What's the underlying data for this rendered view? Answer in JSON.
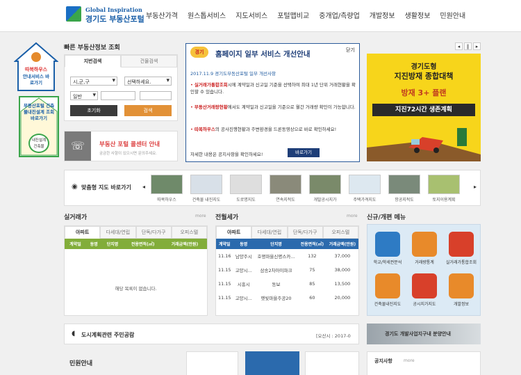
{
  "header": {
    "logo_top": "Global Inspiration",
    "logo_main": "경기도 부동산포털",
    "nav": [
      "부동산가격",
      "원스톱서비스",
      "지도서비스",
      "포털맵비교",
      "중개업/측량업",
      "개발정보",
      "생활정보",
      "민원안내"
    ]
  },
  "left_banners": {
    "ddokbok_title": "따복하우스",
    "ddokbok_sub": "안내서비스 바로가기",
    "design_title": "부동산포털 건축물내진설계 조회 바로가기",
    "design_badge": "내진설계 건축물"
  },
  "quick_search": {
    "title": "빠른 부동산정보 조회",
    "tabs": [
      "지번검색",
      "건물검색"
    ],
    "city": "시,군,구",
    "dong": "선택하세요.",
    "type": "일반",
    "reset": "초기화",
    "search": "검색"
  },
  "call_center": {
    "title": "부동산 포털 콜센터 안내",
    "sub": "궁금한 사항이 있으시면 문의주세요."
  },
  "notice_popup": {
    "badge": "경기",
    "title": "홈페이지 일부 서비스 개선안내",
    "close": "닫기",
    "date_line": "2017.11.9  경기도부동산포털 일부 개선사항",
    "items": [
      {
        "label": "실거래가통합조회",
        "text": "시에 계약일과 신고일 기준을 선택하여 최대 1년 단위 거래현황을 확인할 수 있습니다."
      },
      {
        "label": "부동산거래량현황",
        "text": "에서도 계약일과 신고일을 기준으로 월간 거래량 확인이 가능합니다."
      },
      {
        "label": "따복하우스",
        "text": "의 공사진행현황과 주변환경을 드론동영상으로 바로 확인하세요!"
      }
    ],
    "footer": "자세한 내용은  공지사항을 확인하세요!",
    "go": "바로가기"
  },
  "right_banner": {
    "line1": "경기도형",
    "line2": "지진방재 종합대책",
    "line3": "방재 3+ 플랜",
    "line4": "지진72시간 생존계획"
  },
  "map_strip": {
    "title": "맞춤형 지도 바로가기",
    "items": [
      "따복하우스",
      "건축물 내진지도",
      "도로명지도",
      "연속지적도",
      "개발공시지가",
      "주택가격지도",
      "항공지적도",
      "토지이용계획"
    ]
  },
  "real_trade": {
    "title": "실거래가",
    "more": "more",
    "tabs": [
      "아파트",
      "다세대/연립",
      "단독/다가구",
      "오피스텔"
    ],
    "headers": [
      "계약일",
      "동명",
      "단지명",
      "전용면적(㎡)",
      "거래금액(만원)"
    ],
    "empty": "해당 목록이 없습니다."
  },
  "lease": {
    "title": "전월세가",
    "more": "more",
    "tabs": [
      "아파트",
      "다세대/연립",
      "단독/다가구",
      "오피스텔"
    ],
    "headers": [
      "계약일",
      "동명",
      "단지명",
      "전용면적(㎡)",
      "거래금액(만원)"
    ],
    "rows": [
      [
        "11.16",
        "남양주시",
        "호평마을신명스카...",
        "132",
        "37,000"
      ],
      [
        "11.15",
        "고양시...",
        "삼송2차아이파크",
        "75",
        "38,000"
      ],
      [
        "11.15",
        "시흥시",
        "동보",
        "85",
        "13,500"
      ],
      [
        "11.15",
        "고양시...",
        "햇빛마을주공20",
        "60",
        "20,000"
      ]
    ]
  },
  "new_menu": {
    "title": "신규/개편 메뉴",
    "items": [
      "학교/학세권분석",
      "거래량통계",
      "실거래가통합조회",
      "건축물내진지도",
      "공시지가지도",
      "개발정보"
    ]
  },
  "urban_plan": {
    "text": "도시계획관련 주민공람",
    "meta": "[오산시 : 2017-0"
  },
  "dev_banner": {
    "text": "경기도 개발사업지구내 분양안내"
  },
  "bottom": {
    "minwon": "민원안내",
    "notice": "공지사항",
    "notice_more": "more"
  },
  "slider_controls": [
    "◂",
    "‖",
    "▸"
  ]
}
